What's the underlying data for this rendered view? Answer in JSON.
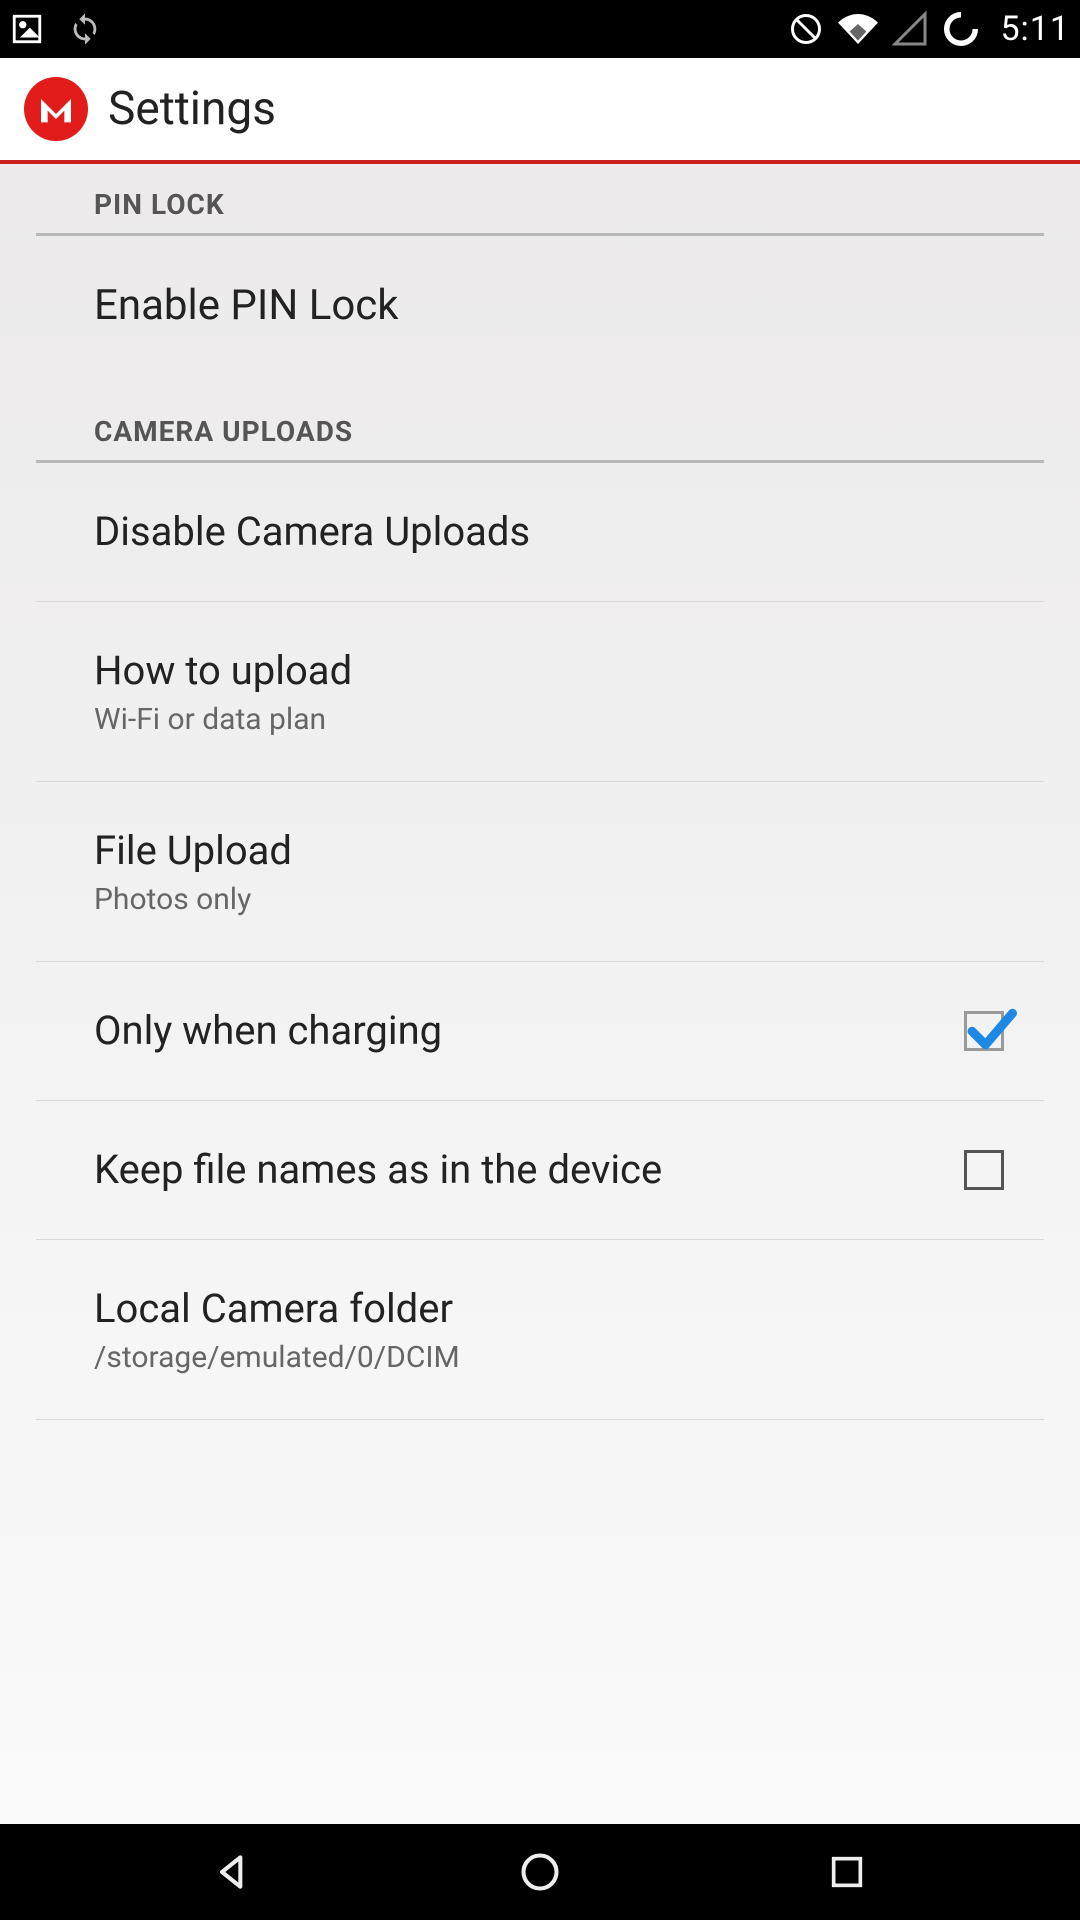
{
  "status": {
    "time": "5:11"
  },
  "appbar": {
    "title": "Settings",
    "logo_letter": "M"
  },
  "sections": {
    "pin_lock_header": "PIN LOCK",
    "camera_uploads_header": "CAMERA UPLOADS"
  },
  "items": {
    "enable_pin": {
      "title": "Enable PIN Lock"
    },
    "disable_cam": {
      "title": "Disable Camera Uploads"
    },
    "how_upload": {
      "title": "How to upload",
      "sub": "Wi-Fi or data plan"
    },
    "file_upload": {
      "title": "File Upload",
      "sub": "Photos only"
    },
    "only_charging": {
      "title": "Only when charging",
      "checked": true
    },
    "keep_names": {
      "title": "Keep file names as in the device",
      "checked": false
    },
    "local_folder": {
      "title": "Local Camera folder",
      "sub": "/storage/emulated/0/DCIM"
    }
  }
}
